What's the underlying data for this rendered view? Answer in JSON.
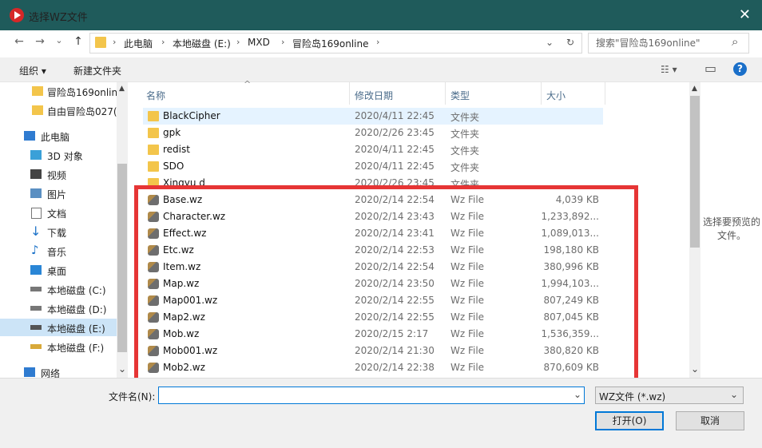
{
  "window": {
    "title": "选择WZ文件",
    "close": "✕"
  },
  "nav": {
    "back": "←",
    "forward": "→",
    "down": "⌄",
    "up": "↑",
    "crumbs": [
      "此电脑",
      "本地磁盘 (E:)",
      "MXD",
      "冒险岛169online"
    ],
    "dropdown": "⌄",
    "refresh": "↻"
  },
  "search": {
    "placeholder": "搜索\"冒险岛169online\"",
    "icon": "⌕"
  },
  "toolbar": {
    "organize": "组织 ▾",
    "new_folder": "新建文件夹",
    "view": "☷ ▾",
    "pane": "▭",
    "help": "?"
  },
  "sidebar": {
    "items": [
      {
        "label": "冒险岛169onlin",
        "icon": "folder"
      },
      {
        "label": "自由冒险岛027(",
        "icon": "folder"
      },
      {
        "label": "此电脑",
        "icon": "pc"
      },
      {
        "label": "3D 对象",
        "icon": "3d"
      },
      {
        "label": "视频",
        "icon": "video"
      },
      {
        "label": "图片",
        "icon": "pictures"
      },
      {
        "label": "文档",
        "icon": "docs"
      },
      {
        "label": "下载",
        "icon": "download"
      },
      {
        "label": "音乐",
        "icon": "music"
      },
      {
        "label": "桌面",
        "icon": "desktop"
      },
      {
        "label": "本地磁盘 (C:)",
        "icon": "drive-c"
      },
      {
        "label": "本地磁盘 (D:)",
        "icon": "drive"
      },
      {
        "label": "本地磁盘 (E:)",
        "icon": "drive"
      },
      {
        "label": "本地磁盘 (F:)",
        "icon": "drive"
      },
      {
        "label": "网络",
        "icon": "network"
      }
    ],
    "scroll_up": "▲",
    "scroll_down": "⌄"
  },
  "columns": {
    "name": "名称",
    "date": "修改日期",
    "type": "类型",
    "size": "大小",
    "sort": "^"
  },
  "rows": [
    {
      "name": "BlackCipher",
      "date": "2020/4/11 22:45",
      "type": "文件夹",
      "size": "",
      "icon": "folder"
    },
    {
      "name": "gpk",
      "date": "2020/2/26 23:45",
      "type": "文件夹",
      "size": "",
      "icon": "folder"
    },
    {
      "name": "redist",
      "date": "2020/4/11 22:45",
      "type": "文件夹",
      "size": "",
      "icon": "folder"
    },
    {
      "name": "SDO",
      "date": "2020/4/11 22:45",
      "type": "文件夹",
      "size": "",
      "icon": "folder"
    },
    {
      "name": "Xingyu d",
      "date": "2020/2/26 23:45",
      "type": "文件夹",
      "size": "",
      "icon": "folder"
    },
    {
      "name": "Base.wz",
      "date": "2020/2/14 22:54",
      "type": "Wz File",
      "size": "4,039 KB",
      "icon": "wz"
    },
    {
      "name": "Character.wz",
      "date": "2020/2/14 23:43",
      "type": "Wz File",
      "size": "1,233,892...",
      "icon": "wz"
    },
    {
      "name": "Effect.wz",
      "date": "2020/2/14 23:41",
      "type": "Wz File",
      "size": "1,089,013...",
      "icon": "wz"
    },
    {
      "name": "Etc.wz",
      "date": "2020/2/14 22:53",
      "type": "Wz File",
      "size": "198,180 KB",
      "icon": "wz"
    },
    {
      "name": "Item.wz",
      "date": "2020/2/14 22:54",
      "type": "Wz File",
      "size": "380,996 KB",
      "icon": "wz"
    },
    {
      "name": "Map.wz",
      "date": "2020/2/14 23:50",
      "type": "Wz File",
      "size": "1,994,103...",
      "icon": "wz"
    },
    {
      "name": "Map001.wz",
      "date": "2020/2/14 22:55",
      "type": "Wz File",
      "size": "807,249 KB",
      "icon": "wz"
    },
    {
      "name": "Map2.wz",
      "date": "2020/2/14 22:55",
      "type": "Wz File",
      "size": "807,045 KB",
      "icon": "wz"
    },
    {
      "name": "Mob.wz",
      "date": "2020/2/15 2:17",
      "type": "Wz File",
      "size": "1,536,359...",
      "icon": "wz"
    },
    {
      "name": "Mob001.wz",
      "date": "2020/2/14 21:30",
      "type": "Wz File",
      "size": "380,820 KB",
      "icon": "wz"
    },
    {
      "name": "Mob2.wz",
      "date": "2020/2/14 22:38",
      "type": "Wz File",
      "size": "870,609 KB",
      "icon": "wz"
    }
  ],
  "preview": {
    "text": "选择要预览的文件。"
  },
  "bottom": {
    "filename_label": "文件名(N):",
    "filename_value": "",
    "filetype": "WZ文件 (*.wz)",
    "open": "打开(O)",
    "cancel": "取消"
  },
  "colors": {
    "titlebar": "#1f5b5b",
    "highlight": "#e63535",
    "accent": "#0078d7"
  }
}
